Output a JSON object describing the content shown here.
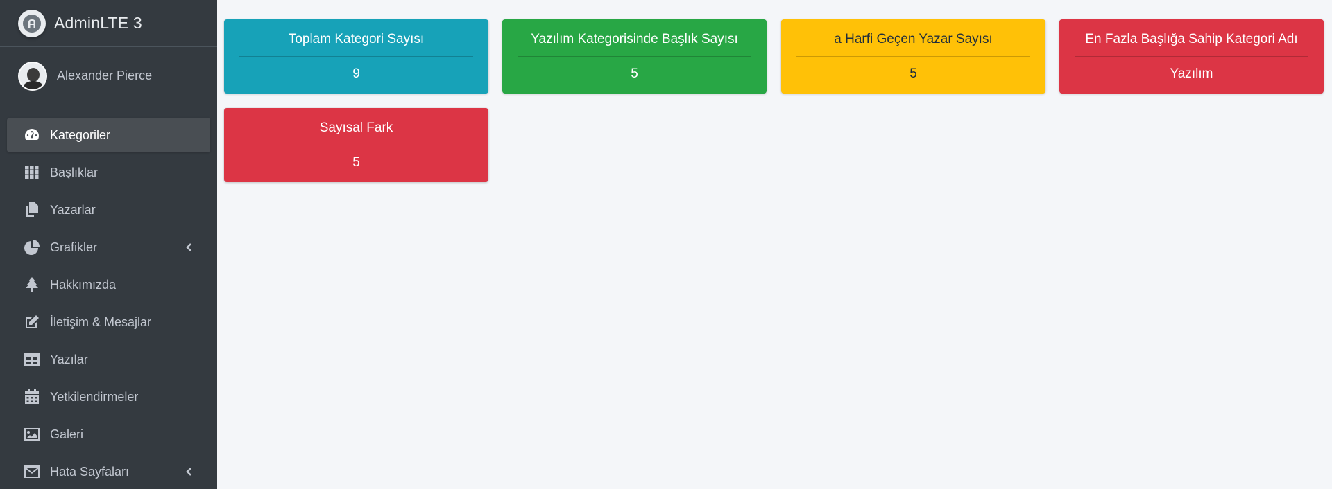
{
  "brand": {
    "name": "AdminLTE 3",
    "icon": "adminlte-logo-icon"
  },
  "user": {
    "name": "Alexander Pierce"
  },
  "sidebar": {
    "items": [
      {
        "label": "Kategoriler",
        "icon": "dashboard-gauge-icon",
        "active": true
      },
      {
        "label": "Başlıklar",
        "icon": "grid-icon"
      },
      {
        "label": "Yazarlar",
        "icon": "copy-icon"
      },
      {
        "label": "Grafikler",
        "icon": "pie-chart-icon",
        "has_submenu": true
      },
      {
        "label": "Hakkımızda",
        "icon": "tree-icon"
      },
      {
        "label": "İletişim & Mesajlar",
        "icon": "edit-icon"
      },
      {
        "label": "Yazılar",
        "icon": "table-icon"
      },
      {
        "label": "Yetkilendirmeler",
        "icon": "calendar-icon"
      },
      {
        "label": "Galeri",
        "icon": "image-icon"
      },
      {
        "label": "Hata Sayfaları",
        "icon": "envelope-icon",
        "has_submenu": true
      }
    ]
  },
  "cards": [
    {
      "title": "Toplam Kategori Sayısı",
      "value": "9",
      "color": "#17a2b8"
    },
    {
      "title": "Yazılım Kategorisinde Başlık Sayısı",
      "value": "5",
      "color": "#28a745"
    },
    {
      "title": "a Harfi Geçen Yazar Sayısı",
      "value": "5",
      "color": "#ffc107"
    },
    {
      "title": "En Fazla Başlığa Sahip Kategori Adı",
      "value": "Yazılım",
      "color": "#dc3545"
    },
    {
      "title": "Sayısal Fark",
      "value": "5",
      "color": "#dc3545"
    }
  ]
}
